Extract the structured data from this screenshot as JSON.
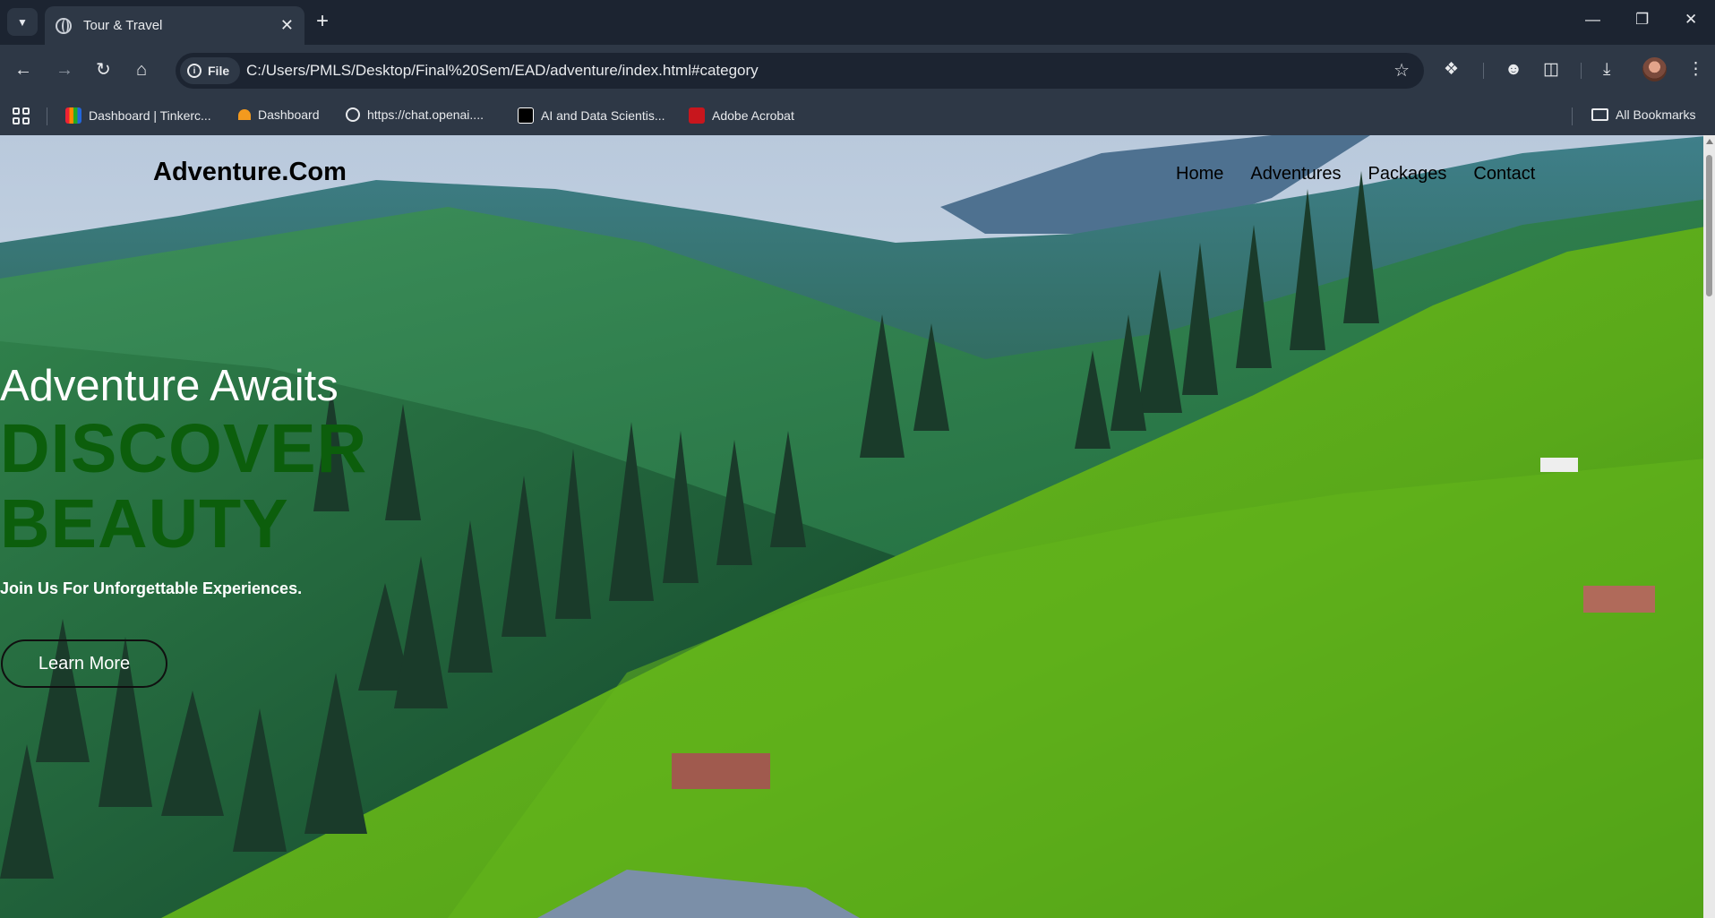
{
  "browser": {
    "tab_title": "Tour & Travel",
    "chip_label": "File",
    "url": "C:/Users/PMLS/Desktop/Final%20Sem/EAD/adventure/index.html#category",
    "bookmarks": [
      {
        "label": "Dashboard | Tinkerc...",
        "icon": "tinkercad-icon"
      },
      {
        "label": "Dashboard",
        "icon": "dashboard-icon"
      },
      {
        "label": "https://chat.openai....",
        "icon": "openai-icon"
      },
      {
        "label": "AI and Data Scientis...",
        "icon": "app-icon"
      },
      {
        "label": "Adobe Acrobat",
        "icon": "acrobat-icon"
      }
    ],
    "all_bookmarks_label": "All Bookmarks"
  },
  "site": {
    "logo": "Adventure.Com",
    "nav": [
      "Home",
      "Adventures",
      "Packages",
      "Contact"
    ],
    "hero": {
      "tagline": "Adventure Awaits",
      "headline_line1": "DISCOVER",
      "headline_line2": "BEAUTY",
      "subline": "Join Us For Unforgettable Experiences.",
      "cta_label": "Learn More"
    }
  },
  "colors": {
    "headline": "#0c5e0c",
    "chrome_dark": "#1c2431",
    "chrome_mid": "#2e3846"
  }
}
